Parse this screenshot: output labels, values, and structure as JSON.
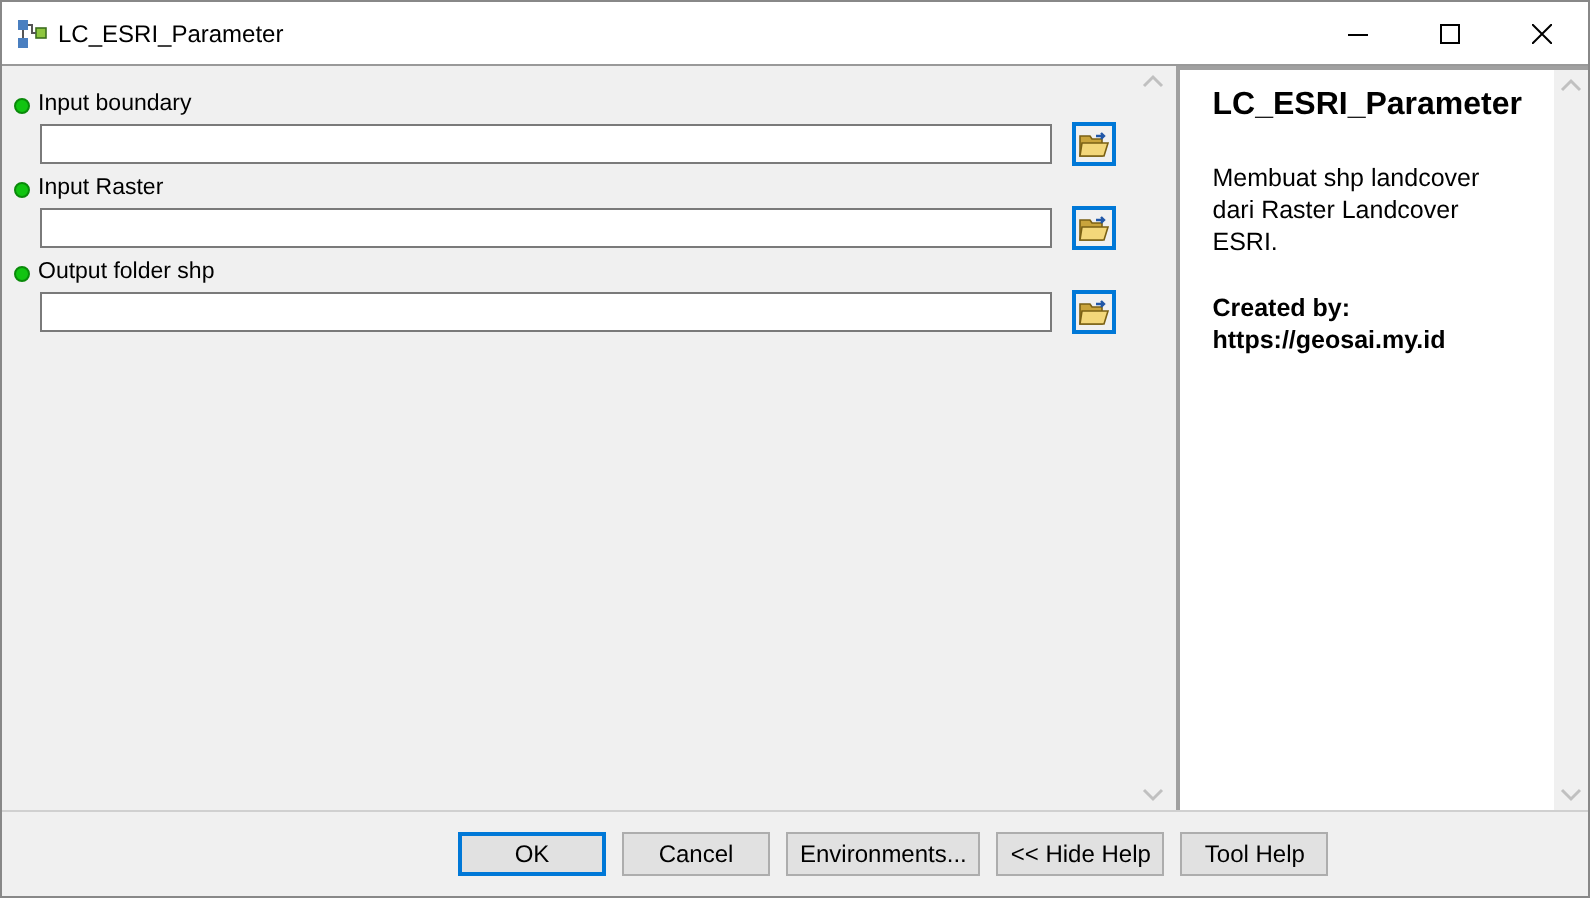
{
  "window": {
    "title": "LC_ESRI_Parameter"
  },
  "parameters": [
    {
      "label": "Input boundary",
      "required": true
    },
    {
      "label": "Input Raster",
      "required": true
    },
    {
      "label": "Output folder shp",
      "required": true
    }
  ],
  "help": {
    "title": "LC_ESRI_Parameter",
    "description": "Membuat shp landcover dari Raster Landcover ESRI.",
    "credit_label": "Created by:",
    "credit_url": "https://geosai.my.id"
  },
  "buttons": [
    {
      "label": "OK",
      "default": true
    },
    {
      "label": "Cancel",
      "default": false
    },
    {
      "label": "Environments...",
      "default": false
    },
    {
      "label": "<< Hide Help",
      "default": false
    },
    {
      "label": "Tool Help",
      "default": false
    }
  ]
}
